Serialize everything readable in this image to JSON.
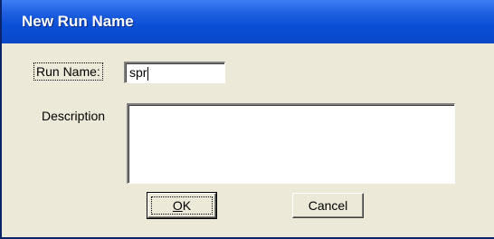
{
  "window": {
    "title": "New Run Name"
  },
  "form": {
    "run_name_label": "Run Name:",
    "run_name_value": "spr",
    "description_label": "Description",
    "description_value": ""
  },
  "buttons": {
    "ok_label": "OK",
    "cancel_label": "Cancel"
  },
  "colors": {
    "titlebar": "#0a4fd6",
    "dialog_bg": "#ece9d8"
  }
}
